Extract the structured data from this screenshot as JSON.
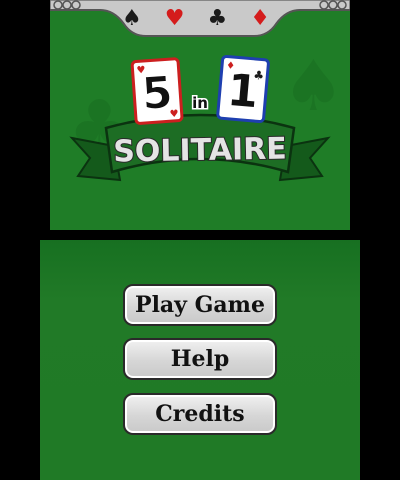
{
  "top_screen": {
    "suits": [
      {
        "glyph": "♠",
        "icon": "spade-icon",
        "color": "#1b1b1b"
      },
      {
        "glyph": "♥",
        "icon": "heart-icon",
        "color": "#d41c1c"
      },
      {
        "glyph": "♣",
        "icon": "club-icon",
        "color": "#1b1b1b"
      },
      {
        "glyph": "♦",
        "icon": "diamond-icon",
        "color": "#d41c1c"
      }
    ],
    "logo": {
      "left_card_number": "5",
      "connector": "in",
      "right_card_number": "1",
      "banner_text": "SOLITAIRE"
    }
  },
  "menu": {
    "play_label": "Play Game",
    "help_label": "Help",
    "credits_label": "Credits"
  },
  "colors": {
    "felt_green": "#1f7d27",
    "banner_green": "#1a6b22",
    "card_border_red": "#cc1f1f",
    "card_border_blue": "#1e3fb0",
    "button_face": "#d6d6d6"
  }
}
